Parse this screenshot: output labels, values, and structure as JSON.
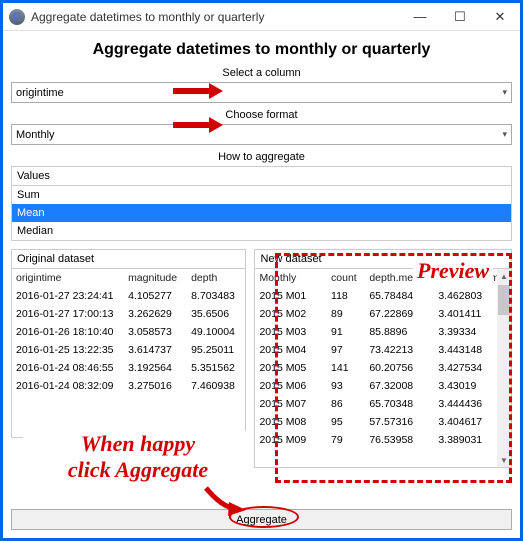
{
  "window": {
    "title": "Aggregate datetimes to monthly or quarterly"
  },
  "page_title": "Aggregate datetimes to monthly or quarterly",
  "select_col_label": "Select a column",
  "column_value": "origintime",
  "choose_format_label": "Choose format",
  "format_value": "Monthly",
  "how_label": "How to aggregate",
  "values_label": "Values",
  "agg_options": [
    "Sum",
    "Mean",
    "Median"
  ],
  "agg_selected_index": 1,
  "left_table": {
    "title": "Original dataset",
    "headers": [
      "origintime",
      "magnitude",
      "depth"
    ],
    "rows": [
      [
        "2016-01-27 23:24:41",
        "4.105277",
        "8.703483"
      ],
      [
        "2016-01-27 17:00:13",
        "3.262629",
        "35.6506"
      ],
      [
        "2016-01-26 18:10:40",
        "3.058573",
        "49.10004"
      ],
      [
        "2016-01-25 13:22:35",
        "3.614737",
        "95.25011"
      ],
      [
        "2016-01-24 08:46:55",
        "3.192564",
        "5.351562"
      ],
      [
        "2016-01-24 08:32:09",
        "3.275016",
        "7.460938"
      ]
    ]
  },
  "right_table": {
    "title": "New dataset",
    "headers": [
      "Monthly",
      "count",
      "depth.mean",
      "magnitude.mean"
    ],
    "rows": [
      [
        "2015 M01",
        "118",
        "65.78484",
        "3.462803"
      ],
      [
        "2015 M02",
        "89",
        "67.22869",
        "3.401411"
      ],
      [
        "2015 M03",
        "91",
        "85.8896",
        "3.39334"
      ],
      [
        "2015 M04",
        "97",
        "73.42213",
        "3.443148"
      ],
      [
        "2015 M05",
        "141",
        "60.20756",
        "3.427534"
      ],
      [
        "2015 M06",
        "93",
        "67.32008",
        "3.43019"
      ],
      [
        "2015 M07",
        "86",
        "65.70348",
        "3.444436"
      ],
      [
        "2015 M08",
        "95",
        "57.57316",
        "3.404617"
      ],
      [
        "2015 M09",
        "79",
        "76.53958",
        "3.389031"
      ]
    ]
  },
  "agg_button": "Aggregate",
  "annotations": {
    "preview": "Preview",
    "happy1": "When happy",
    "happy2": "click Aggregate"
  }
}
